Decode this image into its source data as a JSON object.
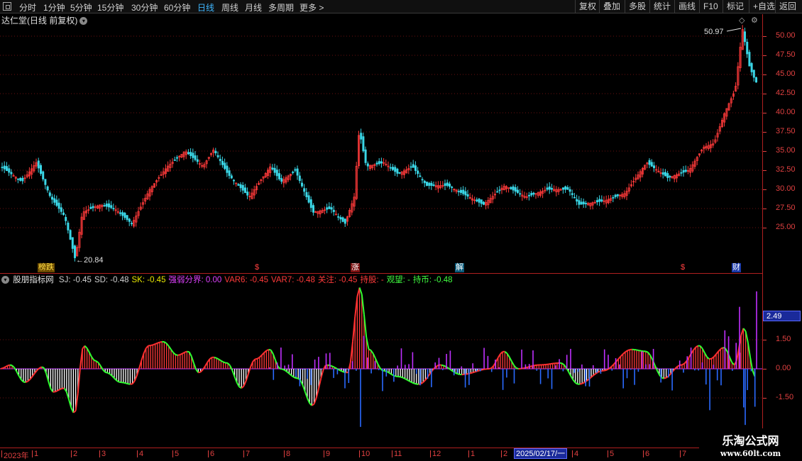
{
  "toolbar": {
    "periods": [
      "分时",
      "1分钟",
      "5分钟",
      "15分钟",
      "30分钟",
      "60分钟",
      "日线",
      "周线",
      "月线",
      "多周期",
      "更多 >"
    ],
    "active_period": "日线",
    "right_buttons": [
      "复权",
      "叠加",
      "多股",
      "统计",
      "画线",
      "F10",
      "+自选",
      "返回"
    ]
  },
  "price_panel": {
    "title": "达仁堂(日线 前复权)",
    "y_ticks": [
      "50.00",
      "47.50",
      "45.00",
      "42.50",
      "40.00",
      "37.50",
      "35.00",
      "32.50",
      "30.00",
      "27.50",
      "25.00"
    ],
    "high_label": "50.97",
    "low_label": "←20.84",
    "markers": [
      "榜跌",
      "$",
      "涨",
      "解",
      "$",
      "财"
    ],
    "colors": {
      "up": "#ff3a3a",
      "down": "#3ad6e6"
    }
  },
  "indicator_panel": {
    "name": "股朋指标网",
    "fields": [
      {
        "label": "SJ:",
        "value": "-0.45",
        "color": "#d0d0d0"
      },
      {
        "label": "SD:",
        "value": "-0.48",
        "color": "#d0d0d0"
      },
      {
        "label": "SK:",
        "value": "-0.45",
        "color": "#e8e800"
      },
      {
        "label": "强弱分界:",
        "value": "0.00",
        "color": "#e040ff"
      },
      {
        "label": "VAR6:",
        "value": "-0.45",
        "color": "#ff3a3a"
      },
      {
        "label": "VAR7:",
        "value": "-0.48",
        "color": "#ff3a3a"
      },
      {
        "label": "关注:",
        "value": "-0.45",
        "color": "#ff3a3a"
      },
      {
        "label": "持股:",
        "value": "-",
        "color": "#ff3a3a"
      },
      {
        "label": "观望:",
        "value": "-",
        "color": "#40ff40"
      },
      {
        "label": "持币:",
        "value": "-0.48",
        "color": "#40ff40"
      }
    ],
    "y_ticks": [
      "1.50",
      "0.00",
      "-1.50"
    ],
    "current_value": "2.49",
    "colors": {
      "pos": "#ff3a3a",
      "neg": "#ffffff",
      "purple": "#c030ff",
      "blue": "#2a6aff",
      "line_up": "#ff3030",
      "line_down": "#30ff30"
    }
  },
  "time_axis": {
    "labels": [
      "2023年",
      "1",
      "2",
      "3",
      "4",
      "5",
      "6",
      "7",
      "8",
      "9",
      "10",
      "11",
      "12",
      "1",
      "2",
      "4",
      "5",
      "6",
      "7"
    ],
    "cursor_label": "2025/02/17/一"
  },
  "watermark": {
    "title": "乐淘公式网",
    "url": "www.60lt.com"
  }
}
